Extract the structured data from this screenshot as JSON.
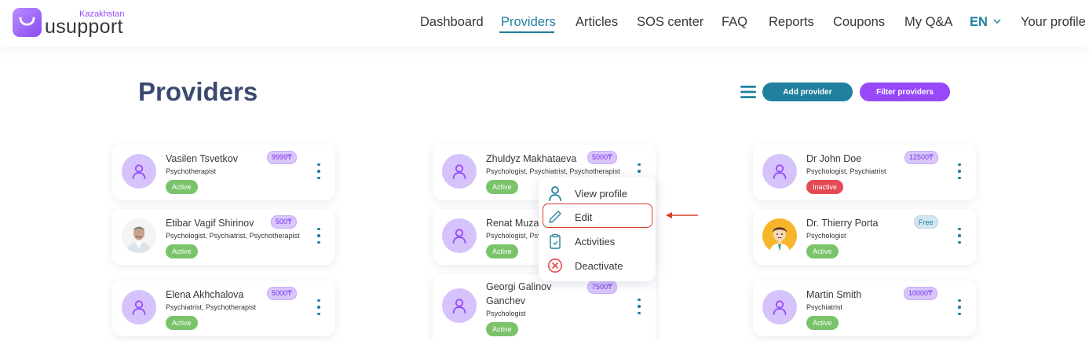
{
  "header": {
    "logo_text": "usupport",
    "logo_region": "Kazakhstan",
    "nav": [
      "Dashboard",
      "Providers",
      "Articles",
      "SOS center",
      "FAQ",
      "Reports",
      "Coupons",
      "My Q&A"
    ],
    "active_nav": "Providers",
    "language": "EN",
    "profile": "Your profile"
  },
  "page": {
    "title": "Providers",
    "add_button": "Add provider",
    "filter_button": "Filter providers"
  },
  "colors": {
    "primary_teal": "#20809e",
    "accent_purple": "#9749fa",
    "active_green": "#7ac36b",
    "inactive_red": "#e54b54",
    "highlight_red": "#d9402b"
  },
  "providers": [
    {
      "name": "Vasilen Tsvetkov",
      "spec": "Psychotherapist",
      "price": "9999₸",
      "status": "Active",
      "avatar": "default-person-icon"
    },
    {
      "name": "Zhuldyz Makhataeva",
      "spec": "Psychologist, Psychiatrist, Psychotherapist",
      "price": "5000₸",
      "status": "Active",
      "avatar": "default-person-icon"
    },
    {
      "name": "Dr John Doe",
      "spec": "Psychologist, Psychiatrist",
      "price": "12500₸",
      "status": "Inactive",
      "avatar": "default-person-icon"
    },
    {
      "name": "Etibar Vagif Shirinov",
      "spec": "Psychologist, Psychiatrist, Psychotherapist",
      "price": "500₸",
      "status": "Active",
      "avatar": "photo"
    },
    {
      "name": "Renat Muzaf",
      "spec": "Psychologist, Psy",
      "price": "",
      "status": "Active",
      "avatar": "default-person-icon"
    },
    {
      "name": "Dr. Thierry Porta",
      "spec": "Psychologist",
      "price": "Free",
      "status": "Active",
      "avatar": "cartoon-doctor"
    },
    {
      "name": "Elena Akhchalova",
      "spec": "Psychiatrist, Psychotherapist",
      "price": "5000₸",
      "status": "Active",
      "avatar": "default-person-icon"
    },
    {
      "name_line1": "Georgi Galinov",
      "name_line2": "Ganchev",
      "spec": "Psychologist",
      "price": "7500₸",
      "status": "Active",
      "avatar": "default-person-icon"
    },
    {
      "name": "Martin Smith",
      "spec": "Psychiatrist",
      "price": "10000₸",
      "status": "Active",
      "avatar": "default-person-icon"
    }
  ],
  "dropdown": {
    "items": [
      {
        "label": "View profile",
        "icon": "person-icon"
      },
      {
        "label": "Edit",
        "icon": "pencil-icon"
      },
      {
        "label": "Activities",
        "icon": "clipboard-icon"
      },
      {
        "label": "Deactivate",
        "icon": "x-circle-icon"
      }
    ],
    "highlighted": "Edit"
  }
}
